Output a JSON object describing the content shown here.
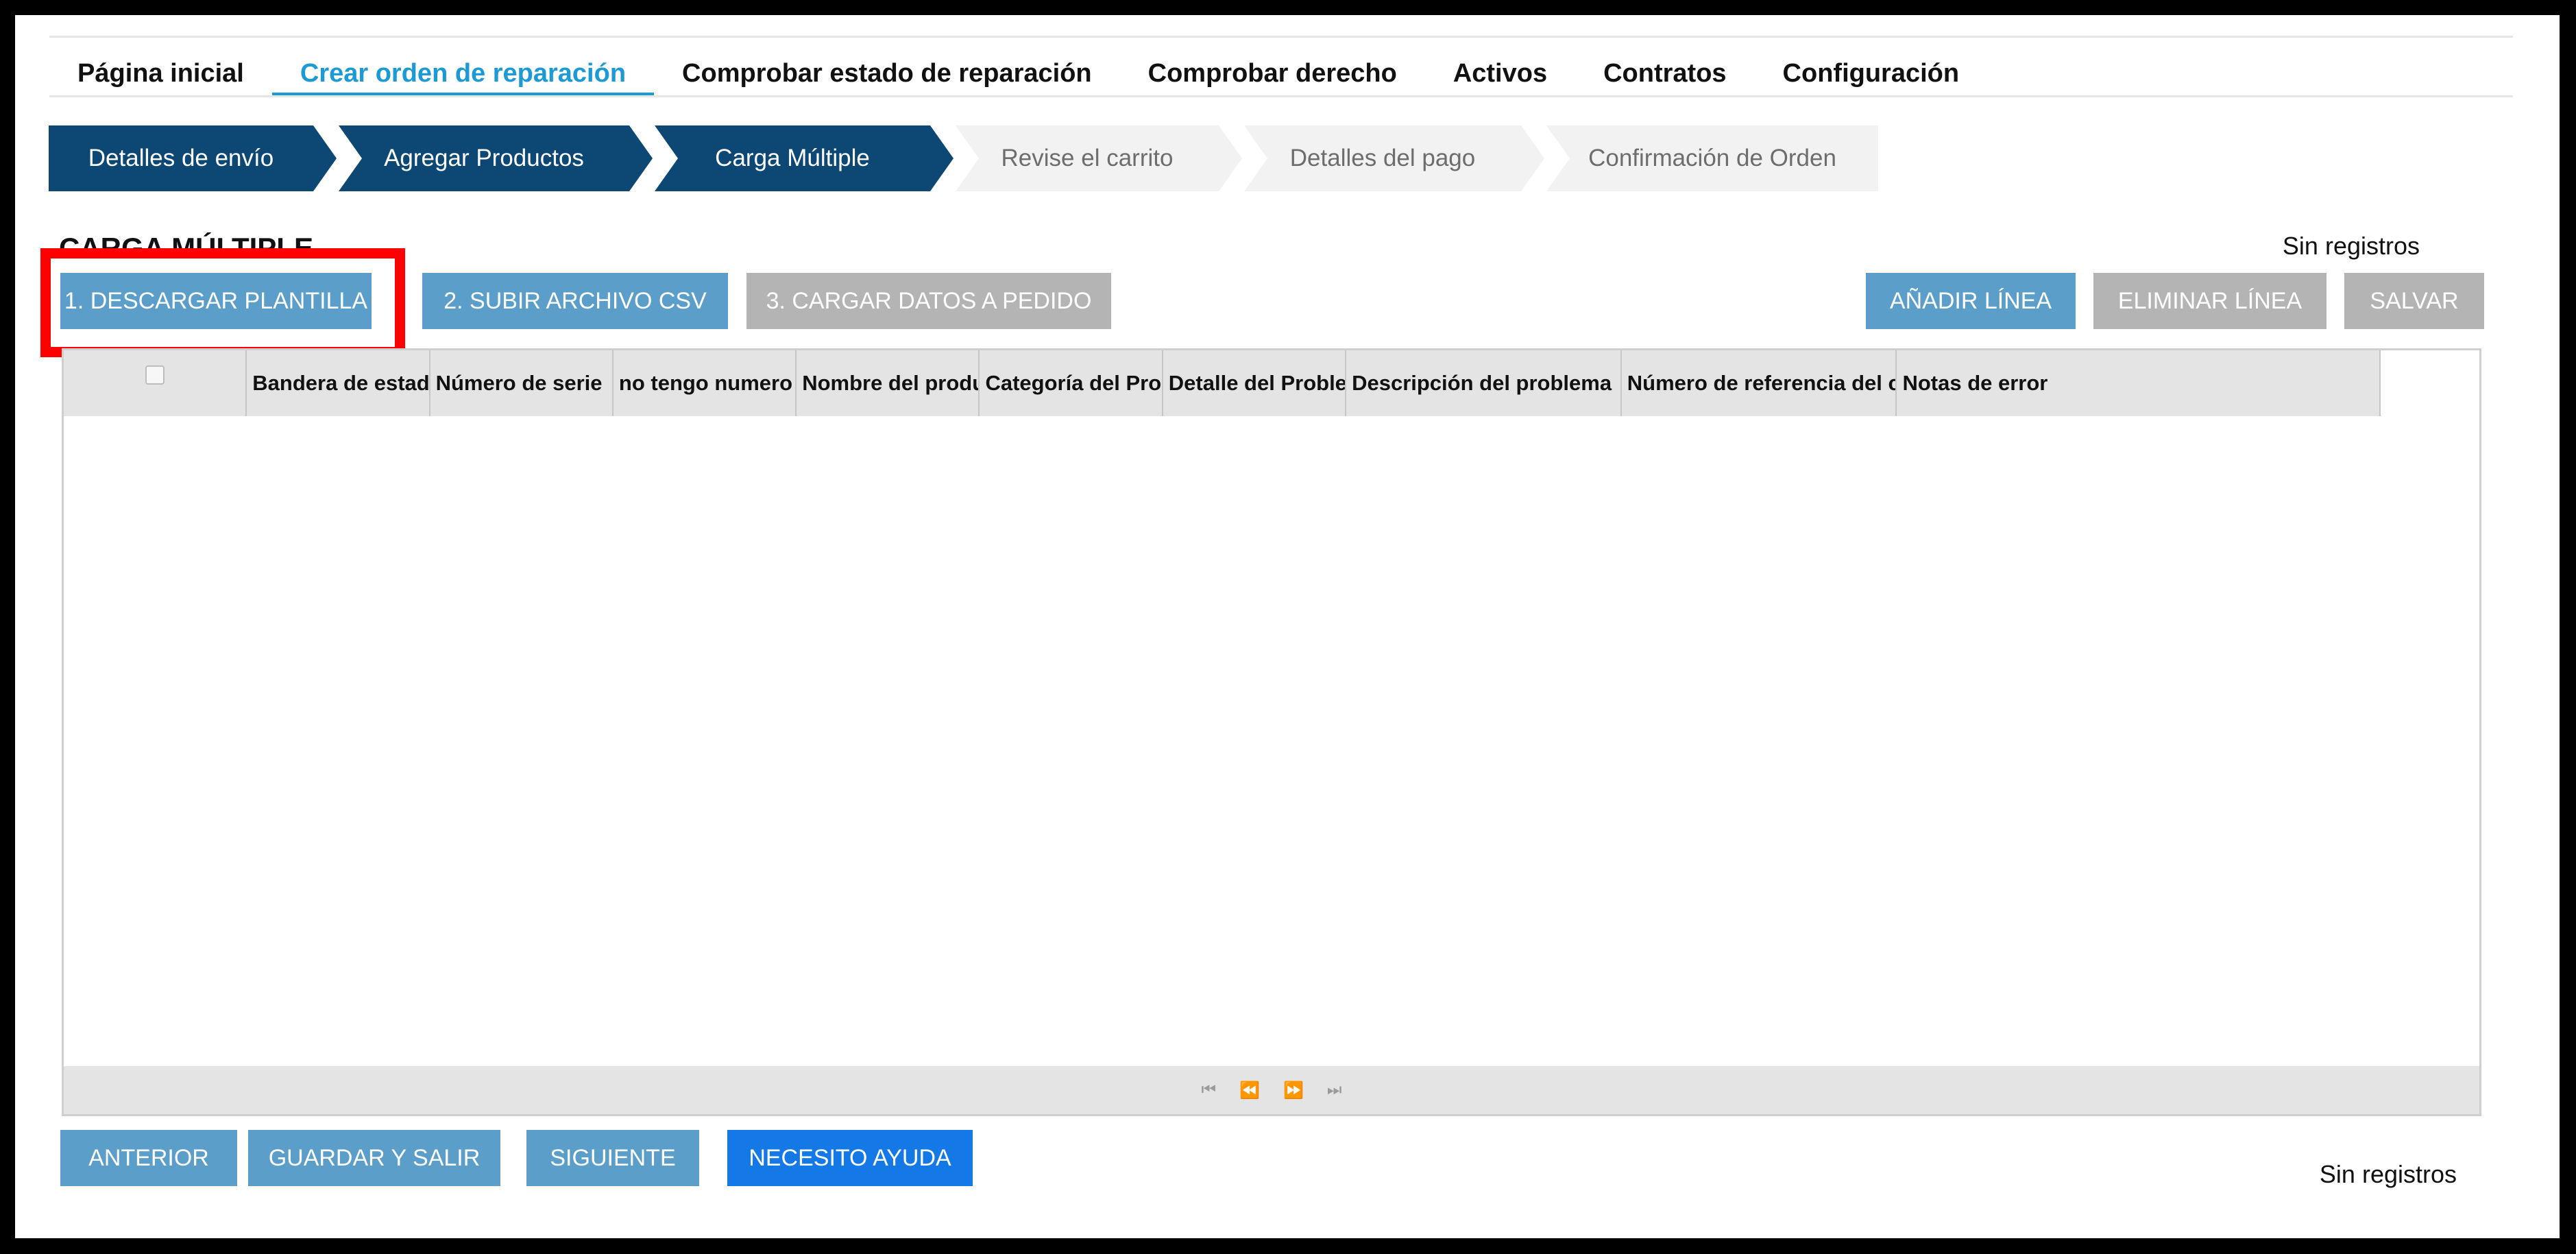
{
  "nav": {
    "tabs": [
      {
        "label": "Página inicial",
        "active": false
      },
      {
        "label": "Crear orden de reparación",
        "active": true
      },
      {
        "label": "Comprobar estado de reparación",
        "active": false
      },
      {
        "label": "Comprobar derecho",
        "active": false
      },
      {
        "label": "Activos",
        "active": false
      },
      {
        "label": "Contratos",
        "active": false
      },
      {
        "label": "Configuración",
        "active": false
      }
    ]
  },
  "steps": [
    {
      "label": "Detalles de envío",
      "state": "done"
    },
    {
      "label": "Agregar Productos",
      "state": "done"
    },
    {
      "label": "Carga Múltiple",
      "state": "done"
    },
    {
      "label": "Revise el carrito",
      "state": "todo"
    },
    {
      "label": "Detalles del pago",
      "state": "todo"
    },
    {
      "label": "Confirmación de Orden",
      "state": "todo"
    }
  ],
  "section": {
    "title": "CARGA MÚLTIPLE",
    "records": "Sin registros"
  },
  "toolbar": {
    "download_template": "1. DESCARGAR PLANTILLA",
    "upload_csv": "2. SUBIR ARCHIVO CSV",
    "load_data": "3. CARGAR DATOS A PEDIDO",
    "add_line": "AÑADIR LÍNEA",
    "delete_line": "ELIMINAR LÍNEA",
    "save": "SALVAR"
  },
  "grid": {
    "columns": [
      "Bandera de estado",
      "Número de serie",
      "no tengo numero de serie",
      "Nombre del producto",
      "Categoría del Problema",
      "Detalle del Problema",
      "Descripción del problema",
      "Número de referencia del cliente",
      "Notas de error"
    ],
    "pager": {
      "first": "⏮",
      "prev": "⏪",
      "next": "⏩",
      "last": "⏭"
    }
  },
  "footer": {
    "previous": "ANTERIOR",
    "save_exit": "GUARDAR Y SALIR",
    "next": "SIGUIENTE",
    "help": "NECESITO AYUDA",
    "records": "Sin registros"
  },
  "colors": {
    "active_tab": "#1b9ad6",
    "step_done": "#0d4774",
    "button_blue": "#5b9ec9",
    "button_grey": "#b4b4b4",
    "help_blue": "#1478e6",
    "highlight": "#ff0000"
  }
}
